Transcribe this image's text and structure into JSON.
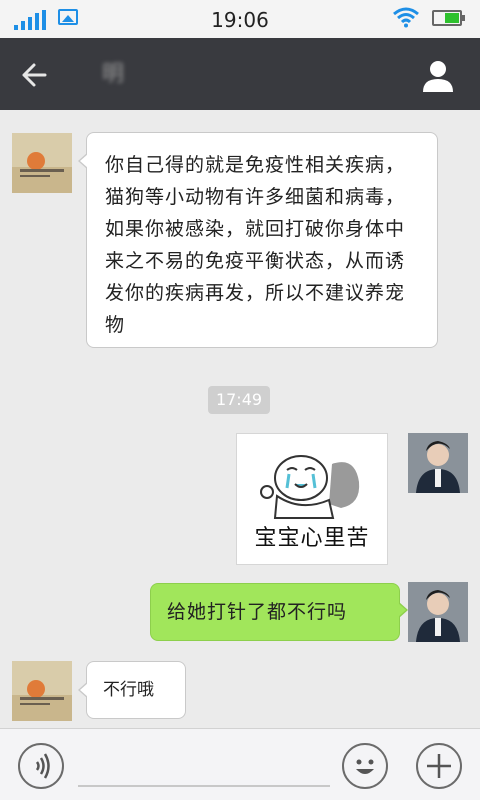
{
  "status_bar": {
    "time": "19:06",
    "icons": [
      "signal-icon",
      "image-icon",
      "wifi-icon",
      "battery-icon"
    ],
    "accent_color": "#1e8fe6"
  },
  "title_bar": {
    "title": "明",
    "back_icon": "back-arrow-icon",
    "profile_icon": "person-icon",
    "background": "#393a3f"
  },
  "messages": [
    {
      "side": "left",
      "type": "text",
      "text": "你自己得的就是免疫性相关疾病，猫狗等小动物有许多细菌和病毒，如果你被感染，就回打破你身体中来之不易的免疫平衡状态，从而诱发你的疾病再发，所以不建议养宠物"
    },
    {
      "type": "timestamp",
      "text": "17:49"
    },
    {
      "side": "right",
      "type": "sticker",
      "caption": "宝宝心里苦"
    },
    {
      "side": "right",
      "type": "text",
      "text": "给她打针了都不行吗",
      "color": "#a1e65b"
    },
    {
      "side": "left",
      "type": "text",
      "text": "不行哦"
    }
  ],
  "input_bar": {
    "voice_icon": "voice-icon",
    "emoji_icon": "emoji-icon",
    "plus_icon": "plus-icon",
    "input_value": ""
  }
}
